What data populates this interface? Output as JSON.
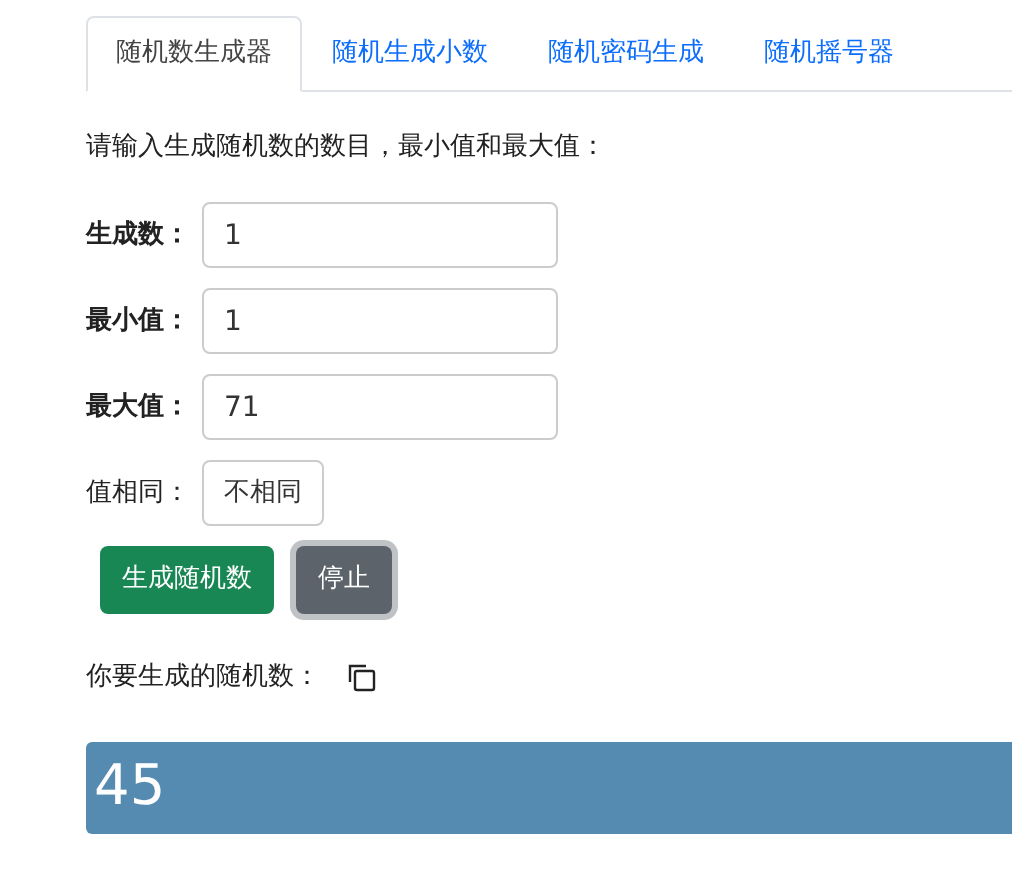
{
  "tabs": [
    {
      "label": "随机数生成器",
      "selected": true
    },
    {
      "label": "随机生成小数",
      "selected": false
    },
    {
      "label": "随机密码生成",
      "selected": false
    },
    {
      "label": "随机摇号器",
      "selected": false
    }
  ],
  "instruction": "请输入生成随机数的数目，最小值和最大值：",
  "fields": [
    {
      "kind": "input",
      "label": "生成数：",
      "value": "1"
    },
    {
      "kind": "input",
      "label": "最小值：",
      "value": "1"
    },
    {
      "kind": "input",
      "label": "最大值：",
      "value": "71"
    },
    {
      "kind": "toggle",
      "label": "值相同：",
      "value": "不相同"
    }
  ],
  "buttons": [
    {
      "kind": "primary",
      "label": "生成随机数",
      "focused": false
    },
    {
      "kind": "secondary",
      "label": "停止",
      "focused": true
    }
  ],
  "result_label": "你要生成的随机数：",
  "result": "45"
}
